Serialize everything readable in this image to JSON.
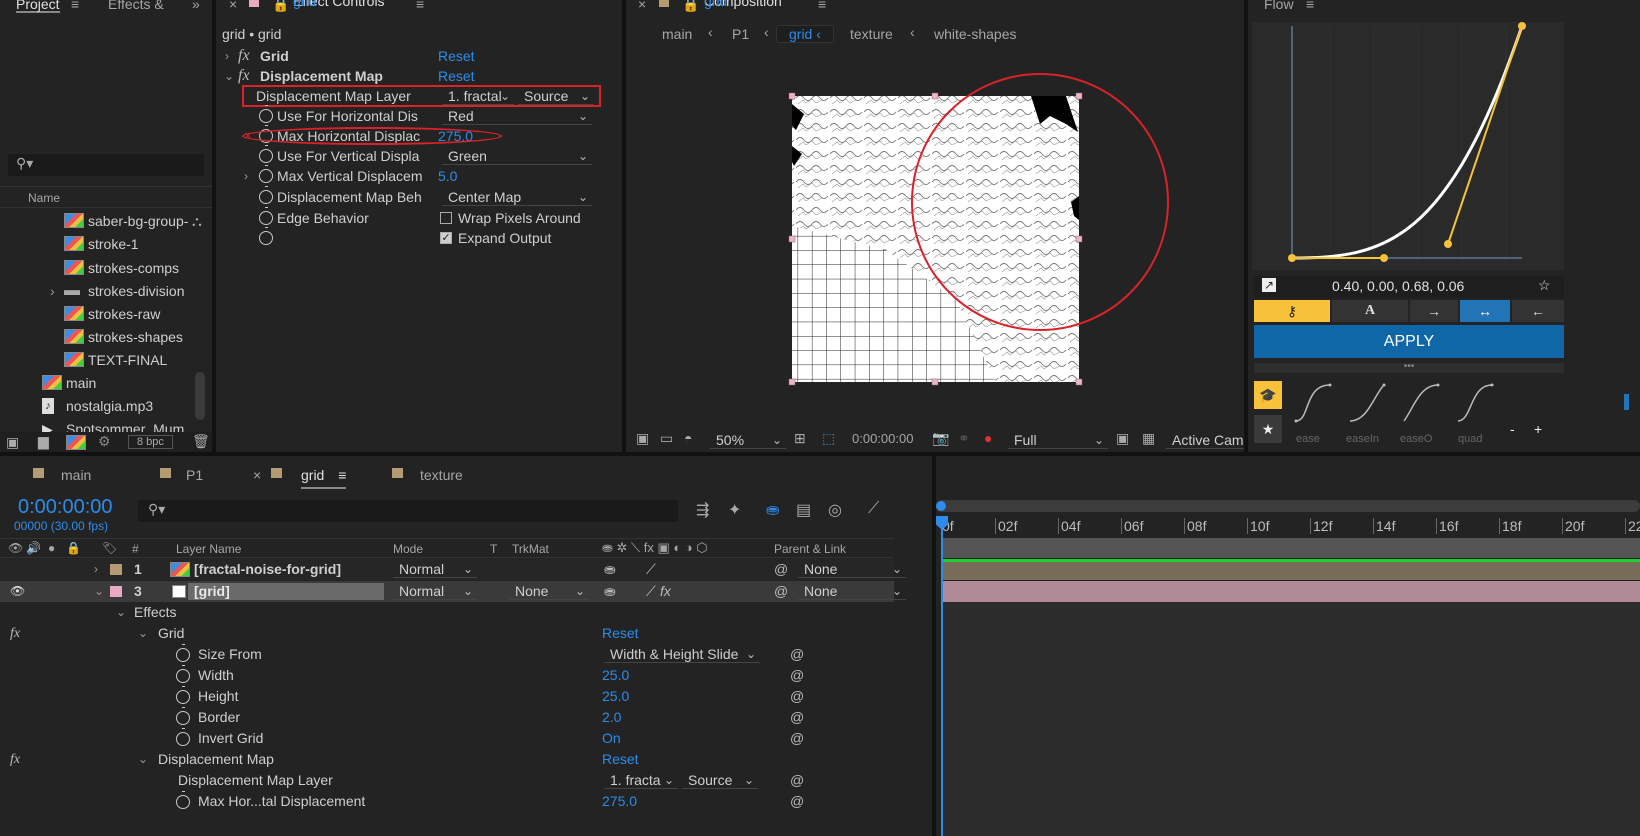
{
  "project_panel": {
    "tabs": [
      "Project",
      "Effects &"
    ],
    "column_name": "Name",
    "items": [
      {
        "label": "saber-bg-group-",
        "type": "comp"
      },
      {
        "label": "stroke-1",
        "type": "comp"
      },
      {
        "label": "strokes-comps",
        "type": "comp"
      },
      {
        "label": "strokes-division",
        "type": "folder"
      },
      {
        "label": "strokes-raw",
        "type": "comp"
      },
      {
        "label": "strokes-shapes",
        "type": "comp"
      },
      {
        "label": "TEXT-FINAL",
        "type": "comp"
      },
      {
        "label": "main",
        "type": "comp"
      },
      {
        "label": "nostalgia.mp3",
        "type": "audio"
      },
      {
        "label": "Spotsommer_Mum",
        "type": "video"
      }
    ],
    "bpc": "8 bpc"
  },
  "effect_controls": {
    "tab_prefix": "Effect Controls",
    "tab_layer": "grid",
    "breadcrumb": "grid • grid",
    "effects": [
      {
        "name": "Grid",
        "reset": "Reset"
      },
      {
        "name": "Displacement Map",
        "reset": "Reset"
      }
    ],
    "props": {
      "map_layer": {
        "label": "Displacement Map Layer",
        "value": "1. fractal",
        "source": "Source"
      },
      "use_h": {
        "label": "Use For Horizontal Dis",
        "value": "Red"
      },
      "max_h": {
        "label": "Max Horizontal Displac",
        "value": "275.0"
      },
      "use_v": {
        "label": "Use For Vertical Displa",
        "value": "Green"
      },
      "max_v": {
        "label": "Max Vertical Displacem",
        "value": "5.0"
      },
      "behavior": {
        "label": "Displacement Map Beh",
        "value": "Center Map"
      },
      "edge": {
        "label": "Edge Behavior",
        "value": "Wrap Pixels Around"
      },
      "expand": {
        "value": "Expand Output"
      }
    }
  },
  "composition": {
    "tab_prefix": "Composition",
    "tab_name": "grid",
    "breadcrumbs": [
      "main",
      "P1",
      "grid",
      "texture",
      "white-shapes"
    ],
    "zoom": "50%",
    "timecode": "0:00:00:00",
    "resolution": "Full",
    "camera": "Active Came"
  },
  "flow": {
    "title": "Flow",
    "values": "0.40, 0.00, 0.68, 0.06",
    "apply": "APPLY",
    "presets": [
      "ease",
      "easeIn",
      "easeO",
      "quad"
    ],
    "minus": "-",
    "plus": "+",
    "colors": {
      "accent": "#f7c23a",
      "apply": "#0f67a8"
    }
  },
  "timeline": {
    "tabs": [
      "main",
      "P1",
      "grid",
      "texture"
    ],
    "timecode": "0:00:00:00",
    "fps": "00000 (30.00 fps)",
    "headers": {
      "layer_name": "Layer Name",
      "mode": "Mode",
      "t": "T",
      "trkmat": "TrkMat",
      "parent": "Parent & Link",
      "num": "#"
    },
    "ruler": [
      "0f",
      "02f",
      "04f",
      "06f",
      "08f",
      "10f",
      "12f",
      "14f",
      "16f",
      "18f",
      "20f",
      "22"
    ],
    "layers": [
      {
        "num": "1",
        "name": "[fractal-noise-for-grid]",
        "mode": "Normal",
        "trkmat": "",
        "parent": "None"
      },
      {
        "num": "3",
        "name": "[grid]",
        "mode": "Normal",
        "trkmat": "None",
        "parent": "None"
      }
    ],
    "effects_label": "Effects",
    "grid_effect": {
      "name": "Grid",
      "reset": "Reset",
      "size_from_label": "Size From",
      "size_from_value": "Width & Height Slide",
      "width_label": "Width",
      "width_value": "25.0",
      "height_label": "Height",
      "height_value": "25.0",
      "border_label": "Border",
      "border_value": "2.0",
      "invert_label": "Invert Grid",
      "invert_value": "On"
    },
    "disp_effect": {
      "name": "Displacement Map",
      "reset": "Reset",
      "layer_label": "Displacement Map Layer",
      "layer_value": "1. fracta",
      "layer_source": "Source",
      "max_label": "Max Hor...tal Displacement",
      "max_value": "275.0"
    }
  }
}
